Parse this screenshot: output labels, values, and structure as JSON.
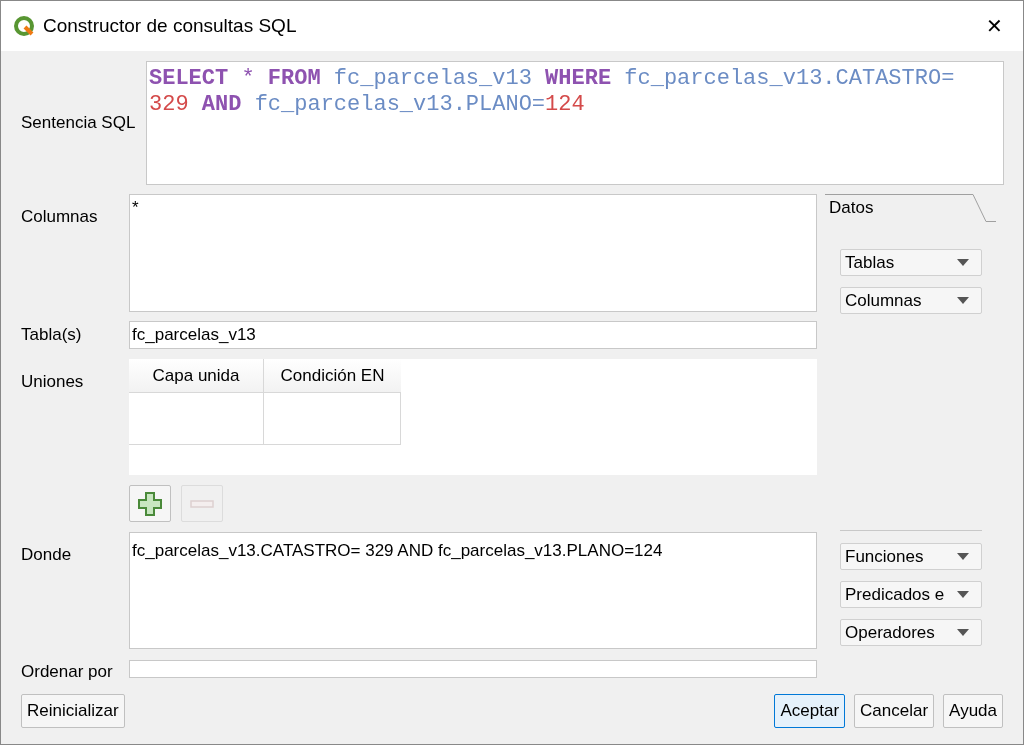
{
  "window": {
    "title": "Constructor de consultas SQL",
    "close": "✕"
  },
  "sql": {
    "label": "Sentencia SQL",
    "lines": [
      [
        {
          "kind": "keyword",
          "text": "SELECT "
        },
        {
          "kind": "operator",
          "text": "* "
        },
        {
          "kind": "keyword",
          "text": "FROM "
        },
        {
          "kind": "identifier",
          "text": "fc_parcelas_v13 "
        },
        {
          "kind": "keyword",
          "text": "WHERE "
        },
        {
          "kind": "identifier",
          "text": "fc_parcelas_v13.CATASTRO="
        }
      ],
      [
        {
          "kind": "number",
          "text": "329 "
        },
        {
          "kind": "keyword",
          "text": "AND "
        },
        {
          "kind": "identifier",
          "text": "fc_parcelas_v13.PLANO="
        },
        {
          "kind": "number",
          "text": "124"
        }
      ]
    ]
  },
  "columns": {
    "label": "Columnas",
    "value": "*"
  },
  "tables": {
    "label": "Tabla(s)",
    "value": "fc_parcelas_v13"
  },
  "joins": {
    "label": "Uniones",
    "columns": [
      "Capa unida",
      "Condición EN"
    ]
  },
  "where": {
    "label": "Donde",
    "value": "fc_parcelas_v13.CATASTRO= 329 AND fc_parcelas_v13.PLANO=124"
  },
  "order": {
    "label": "Ordenar por"
  },
  "data_tab": {
    "label": "Datos",
    "selected": true
  },
  "data_dropdowns": [
    "Tablas",
    "Columnas"
  ],
  "where_dropdowns": [
    "Funciones",
    "Predicados e",
    "Operadores"
  ],
  "buttons_left": [
    "Reinicializar"
  ],
  "buttons_right": [
    {
      "label": "Aceptar",
      "default": true
    },
    {
      "label": "Cancelar",
      "default": false
    },
    {
      "label": "Ayuda",
      "default": false
    }
  ]
}
